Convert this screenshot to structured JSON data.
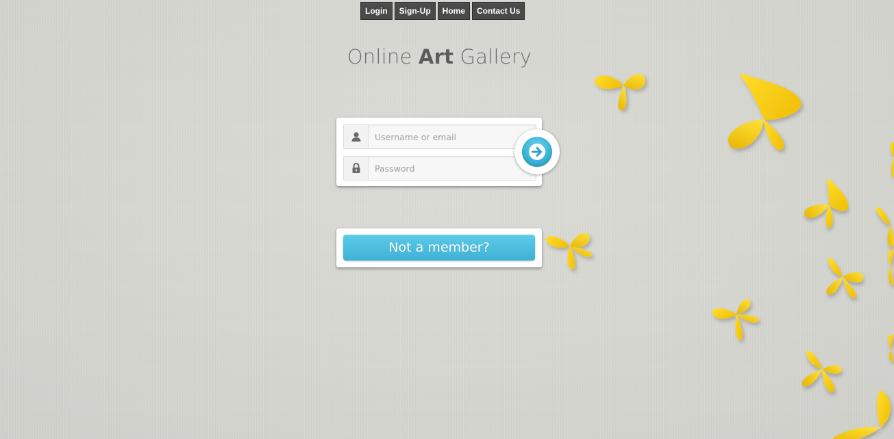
{
  "nav": {
    "items": [
      {
        "label": "Login"
      },
      {
        "label": "Sign-Up"
      },
      {
        "label": "Home"
      },
      {
        "label": "Contact Us"
      }
    ]
  },
  "title": {
    "part1": "Online ",
    "part2": "Art",
    "part3": " Gallery"
  },
  "login": {
    "username_placeholder": "Username or email",
    "username_value": "",
    "password_placeholder": "Password",
    "password_value": "",
    "submit_icon": "arrow-right-icon"
  },
  "member": {
    "button_label": "Not a member?"
  },
  "colors": {
    "accent": "#44b6da",
    "nav_bg": "#4a4a4a",
    "butterfly": "#f7cf12",
    "background": "#d9d9d5"
  },
  "icons": {
    "user": "user-icon",
    "lock": "lock-icon"
  }
}
